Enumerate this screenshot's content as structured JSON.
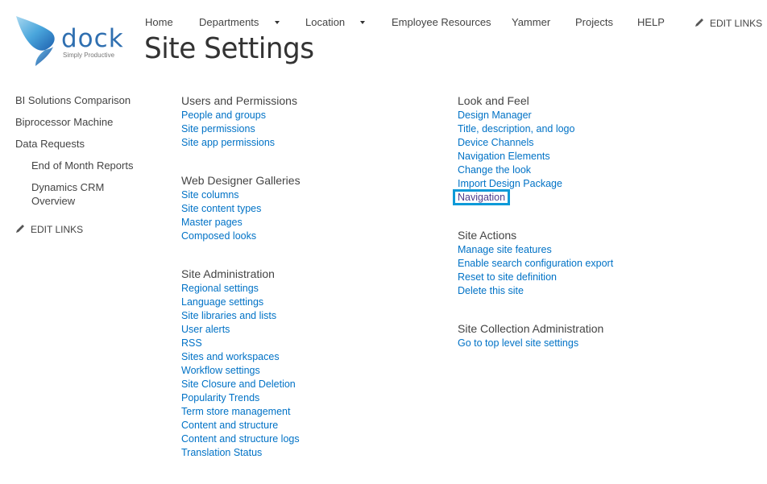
{
  "logo": {
    "name": "dock",
    "tagline": "Simply Productive",
    "colors": {
      "primary": "#2f6fb0",
      "light": "#5ab4e0"
    }
  },
  "topnav": {
    "items": [
      {
        "label": "Home",
        "has_dropdown": false
      },
      {
        "label": "Departments",
        "has_dropdown": true
      },
      {
        "label": "Location",
        "has_dropdown": true
      },
      {
        "label": "Employee Resources",
        "has_dropdown": false
      },
      {
        "label": "Yammer",
        "has_dropdown": false
      },
      {
        "label": "Projects",
        "has_dropdown": false
      },
      {
        "label": "HELP",
        "has_dropdown": false
      }
    ],
    "edit_links": "EDIT LINKS"
  },
  "page_title": "Site Settings",
  "leftnav": {
    "items": [
      {
        "label": "BI Solutions Comparison",
        "level": 1
      },
      {
        "label": "Biprocessor Machine",
        "level": 1
      },
      {
        "label": "Data Requests",
        "level": 1
      },
      {
        "label": "End of Month Reports",
        "level": 2
      },
      {
        "label": "Dynamics CRM Overview",
        "level": 2
      }
    ],
    "edit_links": "EDIT LINKS"
  },
  "groups": {
    "users_permissions": {
      "title": "Users and Permissions",
      "links": [
        "People and groups",
        "Site permissions",
        "Site app permissions"
      ]
    },
    "web_designer_galleries": {
      "title": "Web Designer Galleries",
      "links": [
        "Site columns",
        "Site content types",
        "Master pages",
        "Composed looks"
      ]
    },
    "site_administration": {
      "title": "Site Administration",
      "links": [
        "Regional settings",
        "Language settings",
        "Site libraries and lists",
        "User alerts",
        "RSS",
        "Sites and workspaces",
        "Workflow settings",
        "Site Closure and Deletion",
        "Popularity Trends",
        "Term store management",
        "Content and structure",
        "Content and structure logs",
        "Translation Status"
      ]
    },
    "look_and_feel": {
      "title": "Look and Feel",
      "links": [
        "Design Manager",
        "Title, description, and logo",
        "Device Channels",
        "Navigation Elements",
        "Change the look",
        "Import Design Package",
        "Navigation"
      ],
      "highlighted": "Navigation"
    },
    "site_actions": {
      "title": "Site Actions",
      "links": [
        "Manage site features",
        "Enable search configuration export",
        "Reset to site definition",
        "Delete this site"
      ]
    },
    "site_collection_administration": {
      "title": "Site Collection Administration",
      "links": [
        "Go to top level site settings"
      ]
    }
  },
  "colors": {
    "link": "#0072c6",
    "visited_link": "#4b3c8c",
    "highlight_border": "#0d9ad8",
    "text": "#444444"
  }
}
